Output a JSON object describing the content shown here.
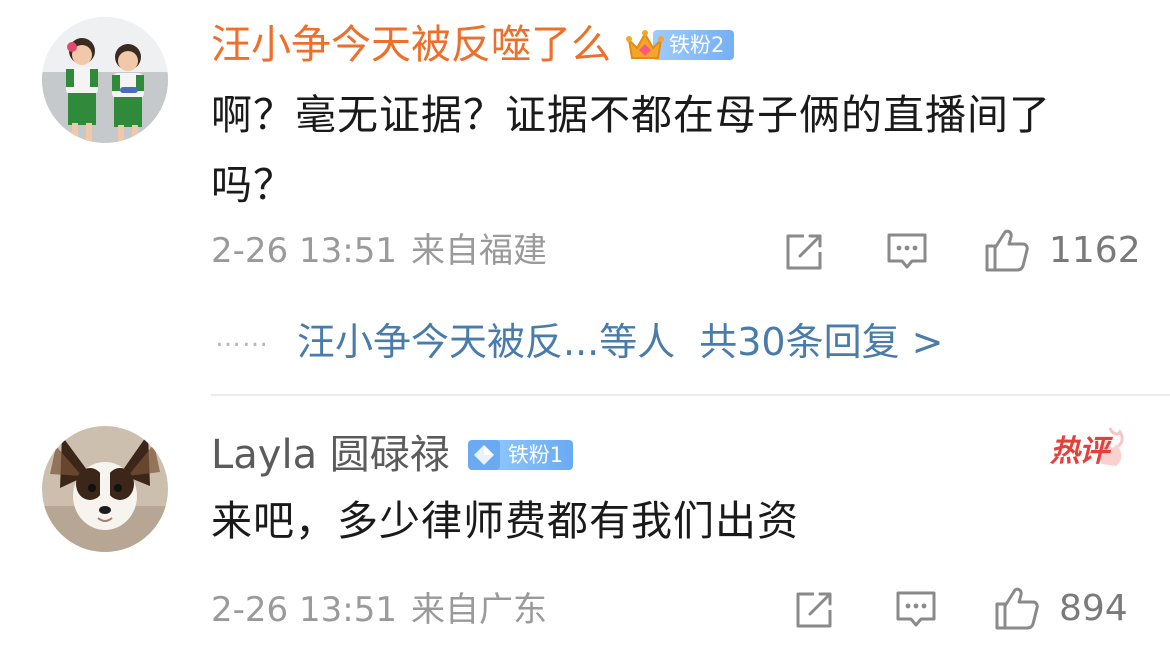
{
  "comments": [
    {
      "username": "汪小争今天被反噬了么",
      "fan_badge": "铁粉2",
      "text": "啊？毫无证据？证据不都在母子俩的直播间了吗？",
      "date": "2-26 13:51",
      "location": "来自福建",
      "likes": "1162",
      "avatar_icon": "avatar-two-girls",
      "badge_icon": "crown-icon"
    },
    {
      "username": "Layla 圆碌禄",
      "fan_badge": "铁粉1",
      "text": "来吧，多少律师费都有我们出资",
      "date": "2-26 13:51",
      "location": "来自广东",
      "likes": "894",
      "hot_tag": "热评",
      "avatar_icon": "avatar-papillon-dog",
      "badge_icon": "diamond-icon"
    }
  ],
  "replies": {
    "dots": "……",
    "others": "汪小争今天被反...等人",
    "total": "共30条回复 >"
  },
  "colors": {
    "username_orange": "#ef6f2a",
    "link_blue": "#4a7cab",
    "hot_red": "#e5413a",
    "badge_blue": "#6aaaf2"
  }
}
